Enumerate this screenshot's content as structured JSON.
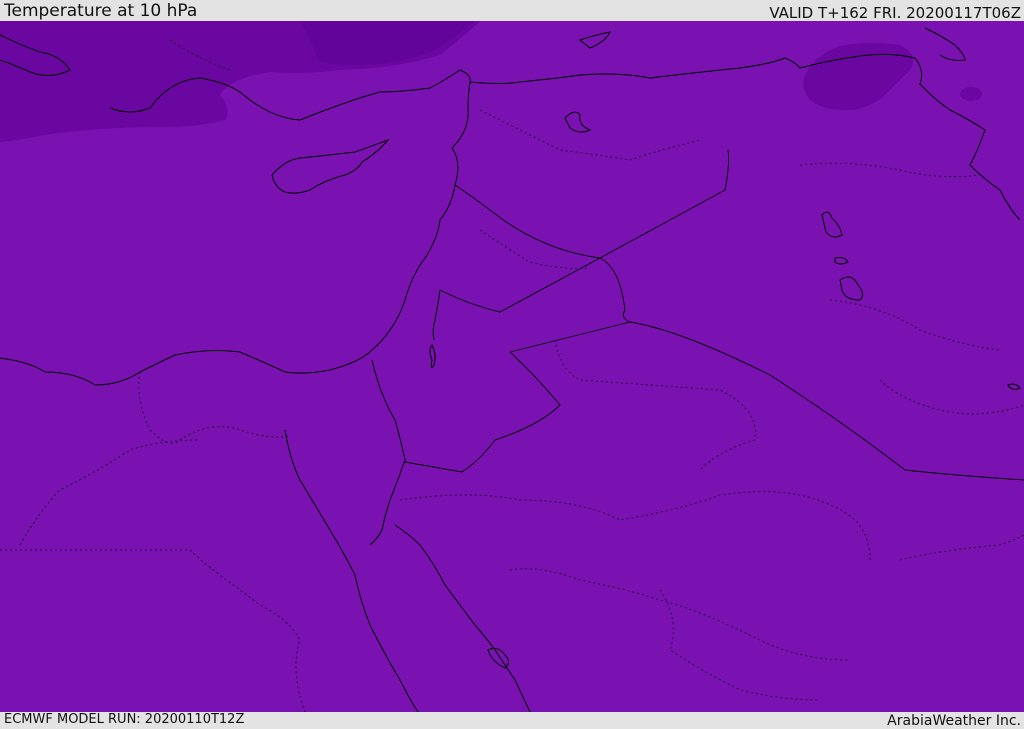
{
  "header": {
    "title": "Temperature at 10 hPa",
    "valid": "VALID T+162 FRI. 20200117T06Z"
  },
  "footer": {
    "model_run": "ECMWF MODEL RUN: 20200110T12Z",
    "brand": "ArabiaWeather Inc."
  },
  "colors": {
    "field_main": "#7a12b2",
    "field_cold": "#6a07a0",
    "coastline": "#000000",
    "bars": "#e3e3e3"
  }
}
